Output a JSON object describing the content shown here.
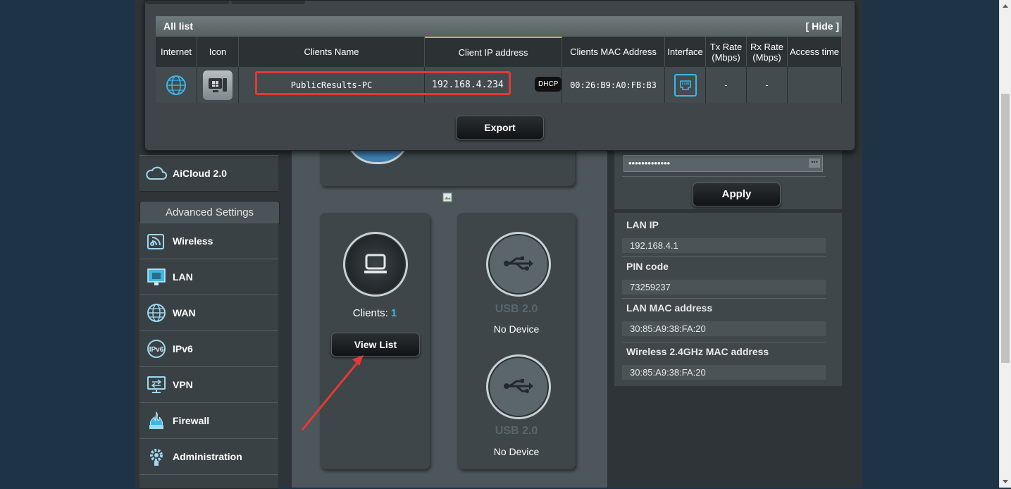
{
  "modal": {
    "title": "All list",
    "hide_label": "[ Hide ]",
    "columns": [
      "Internet",
      "Icon",
      "Clients Name",
      "Client IP address",
      "Clients MAC Address",
      "Interface",
      "Tx Rate\n(Mbps)",
      "Rx Rate\n(Mbps)",
      "Access time"
    ],
    "row": {
      "client_name": "PublicResults-PC",
      "ip": "192.168.4.234",
      "dhcp_badge": "DHCP",
      "mac": "00:26:B9:A0:FB:B3",
      "tx": "-",
      "rx": "-",
      "access_time": ""
    },
    "export_label": "Export"
  },
  "sidebar": {
    "aicloud_label": "AiCloud 2.0",
    "advanced_header": "Advanced Settings",
    "items": [
      {
        "label": "Wireless",
        "icon": "wireless-icon"
      },
      {
        "label": "LAN",
        "icon": "lan-icon"
      },
      {
        "label": "WAN",
        "icon": "globe-icon"
      },
      {
        "label": "IPv6",
        "icon": "ipv6-icon"
      },
      {
        "label": "VPN",
        "icon": "vpn-icon"
      },
      {
        "label": "Firewall",
        "icon": "firewall-icon"
      },
      {
        "label": "Administration",
        "icon": "gear-icon"
      }
    ]
  },
  "center": {
    "clients_label": "Clients:",
    "clients_count": "1",
    "view_list_label": "View List",
    "usb1_label": "USB 2.0",
    "usb1_status": "No Device",
    "usb2_label": "USB 2.0",
    "usb2_status": "No Device"
  },
  "right": {
    "password_mask": "•••••••••••••",
    "apply_label": "Apply",
    "lan_ip_label": "LAN IP",
    "lan_ip": "192.168.4.1",
    "pin_label": "PIN code",
    "pin": "73259237",
    "lan_mac_label": "LAN MAC address",
    "lan_mac": "30:85:A9:38:FA:20",
    "wl_mac_label": "Wireless 2.4GHz MAC address",
    "wl_mac": "30:85:A9:38:FA:20"
  },
  "colors": {
    "highlight_red": "#e53935",
    "accent_blue": "#3db7e4"
  }
}
